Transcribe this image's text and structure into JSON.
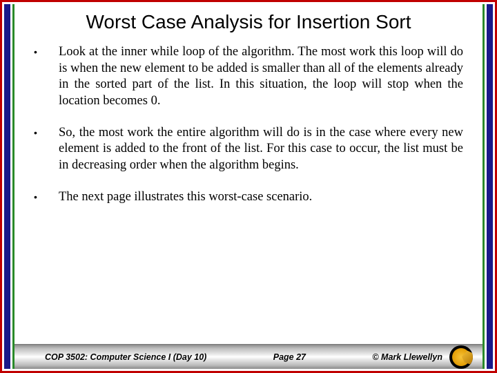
{
  "title": "Worst Case Analysis for Insertion Sort",
  "bullets": [
    "Look at the inner while loop of the algorithm. The most work this loop will do is when the new element to be added is smaller than all of the elements already in the sorted part of the list. In this situation, the loop will stop when the location becomes 0.",
    "So, the most work the entire algorithm will do is in the case where every new element is added to the front of the list. For this case to occur, the list must be in decreasing order when the algorithm begins.",
    "The next page illustrates this worst-case scenario."
  ],
  "footer": {
    "course": "COP 3502: Computer Science I  (Day 10)",
    "page": "Page 27",
    "copyright": "© Mark Llewellyn"
  }
}
